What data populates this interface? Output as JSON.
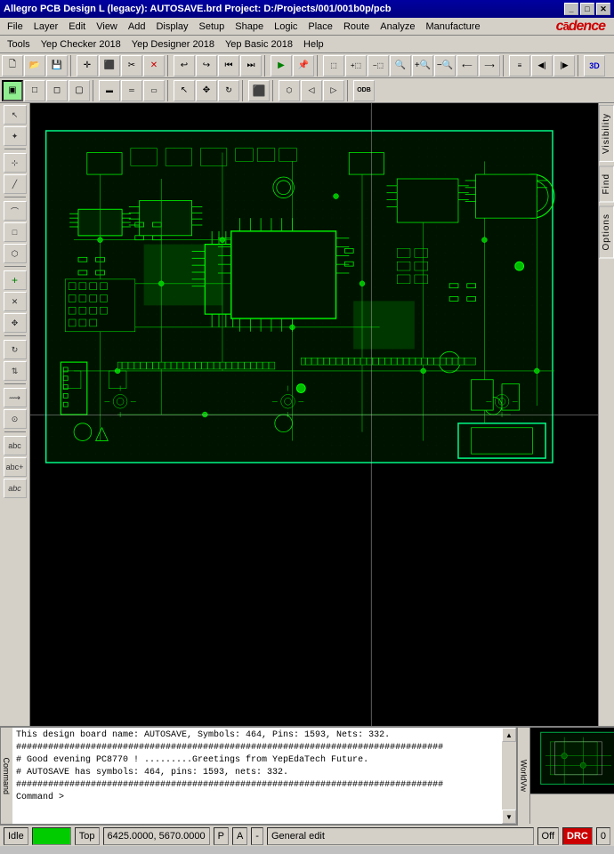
{
  "titlebar": {
    "title": "Allegro PCB Design L (legacy): AUTOSAVE.brd  Project: D:/Projects/001/001b0p/pcb",
    "minimize": "_",
    "maximize": "□",
    "close": "✕"
  },
  "menubar1": {
    "items": [
      "File",
      "Layer",
      "Edit",
      "View",
      "Add",
      "Display",
      "Setup",
      "Shape",
      "Logic",
      "Place",
      "Route",
      "Analyze",
      "Manufacture"
    ]
  },
  "menubar2": {
    "items": [
      "Tools",
      "Yep Checker 2018",
      "Yep Designer 2018",
      "Yep Basic 2018",
      "Help"
    ]
  },
  "logo": "cādence",
  "console": {
    "label": "Command",
    "lines": [
      "This design board name: AUTOSAVE, Symbols: 464, Pins: 1593, Nets: 332.",
      "################################################################################",
      "# Good evening PC8770 !     .........Greetings from YepEdaTech Future.",
      "# AUTOSAVE has symbols: 464, pins: 1593, nets: 332.",
      "################################################################################",
      "Command >"
    ]
  },
  "minimap": {
    "label": "WorldVw"
  },
  "statusbar": {
    "idle": "Idle",
    "led_color": "#00cc00",
    "view": "Top",
    "coords": "6425.0000, 5670.0000",
    "pin_indicator": "P",
    "net_indicator": "A",
    "separator": "-",
    "mode": "General edit",
    "off_label": "Off",
    "drc_label": "DRC",
    "counter": "0"
  },
  "right_tabs": {
    "visibility": "Visibility",
    "find": "Find",
    "options": "Options"
  },
  "toolbar1_icons": [
    "📁",
    "💾",
    "📋",
    "✂️",
    "🔄",
    "↩",
    "↪",
    "⏪",
    "⏩",
    "🔵",
    "📌",
    "📐",
    "🔍",
    "🔍",
    "🔍",
    "🔍",
    "🔍",
    "🔍",
    "🔍",
    "🔍",
    "3D"
  ],
  "toolbar2_icons": [
    "□",
    "□",
    "□",
    "□",
    "□",
    "□",
    "□",
    "□",
    "□",
    "□",
    "□",
    "□",
    "□",
    "□",
    "□",
    "□",
    "□",
    "□",
    "□",
    "⚡"
  ]
}
